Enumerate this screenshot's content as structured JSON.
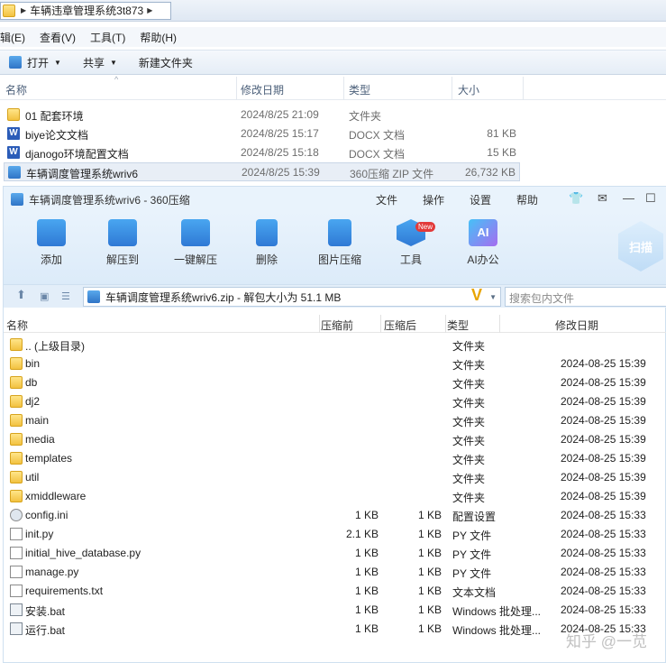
{
  "explorer": {
    "breadcrumb": "车辆违章管理系统3t873",
    "menu": [
      "编辑(E)",
      "查看(V)",
      "工具(T)",
      "帮助(H)"
    ],
    "toolbar": {
      "open": "打开",
      "share": "共享",
      "new_folder": "新建文件夹"
    },
    "columns": {
      "name": "名称",
      "modified": "修改日期",
      "type": "类型",
      "size": "大小"
    },
    "rows": [
      {
        "name": "01 配套环境",
        "modified": "2024/8/25 21:09",
        "type": "文件夹",
        "size": "",
        "icon": "folder-icon"
      },
      {
        "name": "biye论文文档",
        "modified": "2024/8/25 15:17",
        "type": "DOCX 文档",
        "size": "81 KB",
        "icon": "word-icon"
      },
      {
        "name": "djanogo环境配置文档",
        "modified": "2024/8/25 15:18",
        "type": "DOCX 文档",
        "size": "15 KB",
        "icon": "word-icon"
      },
      {
        "name": "车辆调度管理系统wriv6",
        "modified": "2024/8/25 15:39",
        "type": "360压缩 ZIP 文件",
        "size": "26,732 KB",
        "icon": "zip-icon"
      }
    ]
  },
  "zip": {
    "title": "车辆调度管理系统wriv6 - 360压缩",
    "menu": [
      "文件",
      "操作",
      "设置",
      "帮助"
    ],
    "tools": [
      "添加",
      "解压到",
      "一键解压",
      "删除",
      "图片压缩",
      "工具",
      "AI办公"
    ],
    "new_badge": "New",
    "scan": "扫描",
    "path": "车辆调度管理系统wriv6.zip - 解包大小为 51.1 MB",
    "search_placeholder": "搜索包内文件",
    "columns": {
      "name": "名称",
      "compressed": "压缩前",
      "uncompressed": "压缩后",
      "type": "类型",
      "modified": "修改日期"
    },
    "rows": [
      {
        "name": ".. (上级目录)",
        "c": "",
        "u": "",
        "type": "文件夹",
        "modified": "",
        "icon": "folder-icon"
      },
      {
        "name": "bin",
        "c": "",
        "u": "",
        "type": "文件夹",
        "modified": "2024-08-25 15:39",
        "icon": "folder-icon"
      },
      {
        "name": "db",
        "c": "",
        "u": "",
        "type": "文件夹",
        "modified": "2024-08-25 15:39",
        "icon": "folder-icon"
      },
      {
        "name": "dj2",
        "c": "",
        "u": "",
        "type": "文件夹",
        "modified": "2024-08-25 15:39",
        "icon": "folder-icon"
      },
      {
        "name": "main",
        "c": "",
        "u": "",
        "type": "文件夹",
        "modified": "2024-08-25 15:39",
        "icon": "folder-icon"
      },
      {
        "name": "media",
        "c": "",
        "u": "",
        "type": "文件夹",
        "modified": "2024-08-25 15:39",
        "icon": "folder-icon"
      },
      {
        "name": "templates",
        "c": "",
        "u": "",
        "type": "文件夹",
        "modified": "2024-08-25 15:39",
        "icon": "folder-icon"
      },
      {
        "name": "util",
        "c": "",
        "u": "",
        "type": "文件夹",
        "modified": "2024-08-25 15:39",
        "icon": "folder-icon"
      },
      {
        "name": "xmiddleware",
        "c": "",
        "u": "",
        "type": "文件夹",
        "modified": "2024-08-25 15:39",
        "icon": "folder-icon"
      },
      {
        "name": "config.ini",
        "c": "1 KB",
        "u": "1 KB",
        "type": "配置设置",
        "modified": "2024-08-25 15:33",
        "icon": "config-file-icon"
      },
      {
        "name": "init.py",
        "c": "2.1 KB",
        "u": "1 KB",
        "type": "PY 文件",
        "modified": "2024-08-25 15:33",
        "icon": "file-icon"
      },
      {
        "name": "initial_hive_database.py",
        "c": "1 KB",
        "u": "1 KB",
        "type": "PY 文件",
        "modified": "2024-08-25 15:33",
        "icon": "file-icon"
      },
      {
        "name": "manage.py",
        "c": "1 KB",
        "u": "1 KB",
        "type": "PY 文件",
        "modified": "2024-08-25 15:33",
        "icon": "file-icon"
      },
      {
        "name": "requirements.txt",
        "c": "1 KB",
        "u": "1 KB",
        "type": "文本文档",
        "modified": "2024-08-25 15:33",
        "icon": "file-icon"
      },
      {
        "name": "安装.bat",
        "c": "1 KB",
        "u": "1 KB",
        "type": "Windows 批处理...",
        "modified": "2024-08-25 15:33",
        "icon": "bat-icon"
      },
      {
        "name": "运行.bat",
        "c": "1 KB",
        "u": "1 KB",
        "type": "Windows 批处理...",
        "modified": "2024-08-25 15:33",
        "icon": "bat-icon"
      }
    ]
  },
  "watermark": "知乎 @一苋"
}
